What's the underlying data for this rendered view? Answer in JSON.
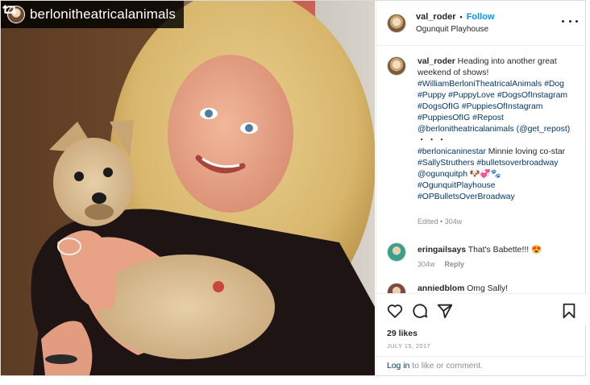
{
  "repost": {
    "username": "berlonitheatricalanimals"
  },
  "post_header": {
    "username": "val_roder",
    "separator": "•",
    "follow_label": "Follow",
    "location": "Ogunquit Playhouse"
  },
  "caption": {
    "username": "val_roder",
    "segments": [
      {
        "type": "text",
        "value": " Heading into another great weekend of shows! "
      },
      {
        "type": "tag",
        "value": "#WilliamBerloniTheatricalAnimals"
      },
      {
        "type": "text",
        "value": " "
      },
      {
        "type": "tag",
        "value": "#Dog"
      },
      {
        "type": "text",
        "value": " "
      },
      {
        "type": "tag",
        "value": "#Puppy"
      },
      {
        "type": "text",
        "value": " "
      },
      {
        "type": "tag",
        "value": "#PuppyLove"
      },
      {
        "type": "text",
        "value": " "
      },
      {
        "type": "tag",
        "value": "#DogsOfInstagram"
      },
      {
        "type": "text",
        "value": " "
      },
      {
        "type": "tag",
        "value": "#DogsOfIG"
      },
      {
        "type": "text",
        "value": " "
      },
      {
        "type": "tag",
        "value": "#PuppiesOfInstagram"
      },
      {
        "type": "text",
        "value": " "
      },
      {
        "type": "tag",
        "value": "#PuppiesOfIG"
      },
      {
        "type": "text",
        "value": " "
      },
      {
        "type": "tag",
        "value": "#Repost"
      },
      {
        "type": "text",
        "value": " "
      },
      {
        "type": "tag",
        "value": "@berlonitheatricalanimals"
      },
      {
        "type": "text",
        "value": " "
      },
      {
        "type": "tag",
        "value": "(@get_repost)"
      },
      {
        "type": "break",
        "value": ""
      },
      {
        "type": "text",
        "value": "・・・"
      },
      {
        "type": "break",
        "value": ""
      },
      {
        "type": "tag",
        "value": "#berlonicaninestar"
      },
      {
        "type": "text",
        "value": " Minnie loving co-star "
      },
      {
        "type": "tag",
        "value": "#SallyStruthers"
      },
      {
        "type": "text",
        "value": " "
      },
      {
        "type": "tag",
        "value": "#bulletsoverbroadway"
      },
      {
        "type": "text",
        "value": " "
      },
      {
        "type": "tag",
        "value": "@ogunquitph"
      },
      {
        "type": "text",
        "value": " 🐶💞🐾"
      },
      {
        "type": "tag",
        "value": "#OgunquitPlayhouse"
      },
      {
        "type": "text",
        "value": " "
      },
      {
        "type": "tag",
        "value": "#OPBulletsOverBroadway"
      }
    ],
    "edited_label": "Edited",
    "meta_separator": "•",
    "age": "304w"
  },
  "comments": [
    {
      "username": "eringailsays",
      "text": "That's Babette!!! 😍",
      "age": "304w",
      "reply_label": "Reply"
    },
    {
      "username": "anniedblom",
      "text": "Omg Sally!"
    }
  ],
  "likes_label": "29 likes",
  "date_label": "JULY 15, 2017",
  "login": {
    "link": "Log in",
    "rest": " to like or comment."
  },
  "icons": {
    "repost": "repost-icon",
    "more": "more-options-icon",
    "like": "heart-icon",
    "comment": "comment-icon",
    "share": "share-icon",
    "save": "bookmark-icon"
  },
  "colors": {
    "link_blue": "#0095f6",
    "hashtag": "#00376b",
    "muted": "#8e8e8e",
    "text": "#262626"
  }
}
